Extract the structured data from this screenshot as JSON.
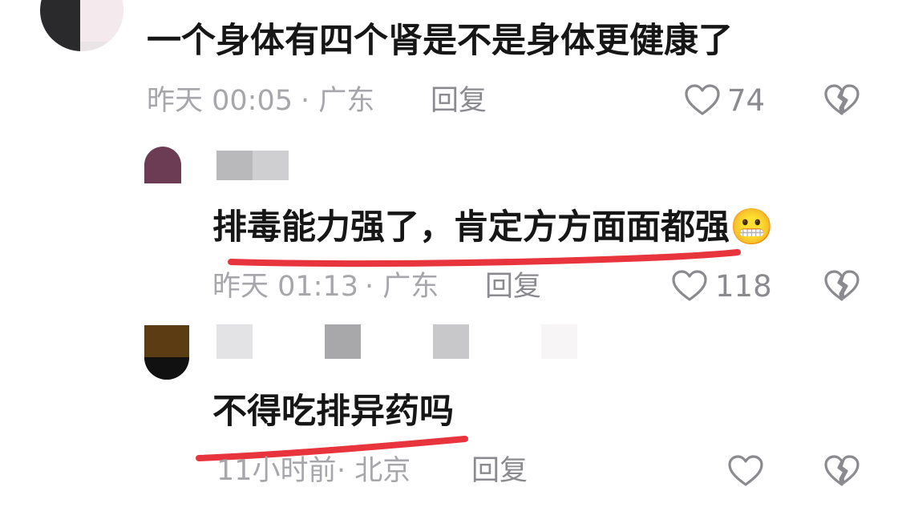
{
  "comments": [
    {
      "text": "一个身体有四个肾是不是身体更健康了",
      "time": "昨天 00:05",
      "location": "· 广东",
      "reply_label": "回复",
      "likes": "74"
    },
    {
      "text": "排毒能力强了，肯定方方面面都强",
      "emoji": "😬",
      "time": "昨天 01:13",
      "location": "· 广东",
      "reply_label": "回复",
      "likes": "118"
    },
    {
      "text": "不得吃排异药吗",
      "time": "11小时前",
      "location": "· 北京",
      "reply_label": "回复",
      "likes": ""
    }
  ],
  "icons": {
    "like": "heart-outline-icon",
    "dislike": "broken-heart-icon"
  },
  "colors": {
    "highlight_underline": "#e8343c",
    "meta_text": "#a6a6ab",
    "comment_text": "#161616"
  }
}
